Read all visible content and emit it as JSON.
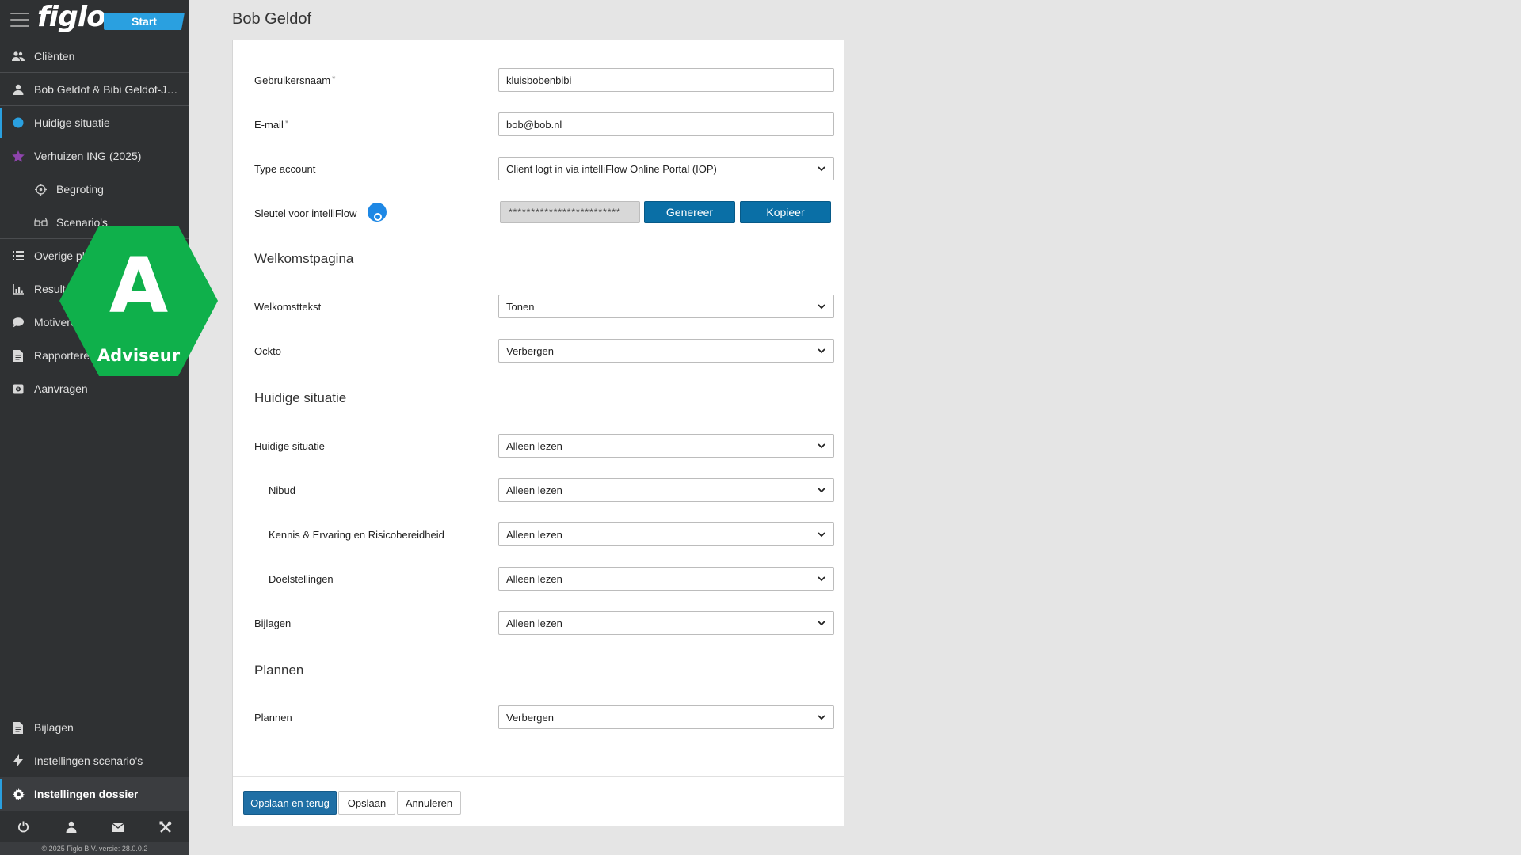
{
  "sidebar": {
    "logo": "figlo",
    "start_label": "Start",
    "items": [
      {
        "label": "Cliënten",
        "icon": "users-icon"
      },
      {
        "label": "Bob Geldof & Bibi Geldof-Jele...",
        "icon": "user-icon"
      },
      {
        "label": "Huidige situatie",
        "icon": "circle-icon"
      },
      {
        "label": "Verhuizen ING (2025)",
        "icon": "star-icon"
      },
      {
        "label": "Begroting",
        "icon": "target-icon"
      },
      {
        "label": "Scenario's",
        "icon": "glasses-icon"
      },
      {
        "label": "Overige plannen",
        "icon": "list-icon"
      },
      {
        "label": "Resultaten",
        "icon": "chart-icon"
      },
      {
        "label": "Motiveren",
        "icon": "speech-bubble-icon"
      },
      {
        "label": "Rapporteren",
        "icon": "document-icon"
      },
      {
        "label": "Aanvragen",
        "icon": "send-icon"
      }
    ],
    "bottom_items": [
      {
        "label": "Bijlagen",
        "icon": "file-icon"
      },
      {
        "label": "Instellingen scenario's",
        "icon": "bolt-icon"
      },
      {
        "label": "Instellingen dossier",
        "icon": "gear-icon"
      }
    ],
    "copyright": "© 2025 Figlo B.V. versie: 28.0.0.2"
  },
  "badge": {
    "letter": "A",
    "label": "Adviseur",
    "color": "#0fb04b"
  },
  "page": {
    "title": "Bob Geldof"
  },
  "form": {
    "username": {
      "label": "Gebruikersnaam",
      "value": "kluisbobenbibi"
    },
    "email": {
      "label": "E-mail",
      "value": "bob@bob.nl"
    },
    "account_type": {
      "label": "Type account",
      "value": "Client logt in via intelliFlow Online Portal (IOP)"
    },
    "key": {
      "label": "Sleutel voor intelliFlow",
      "value": "*************************",
      "generate": "Genereer",
      "copy": "Kopieer"
    },
    "section_welcome": "Welkomstpagina",
    "welcome_text": {
      "label": "Welkomsttekst",
      "value": "Tonen"
    },
    "ockto": {
      "label": "Ockto",
      "value": "Verbergen"
    },
    "section_current": "Huidige situatie",
    "current": {
      "label": "Huidige situatie",
      "value": "Alleen lezen"
    },
    "nibud": {
      "label": "Nibud",
      "value": "Alleen lezen"
    },
    "knowledge": {
      "label": "Kennis & Ervaring en Risicobereidheid",
      "value": "Alleen lezen"
    },
    "goals": {
      "label": "Doelstellingen",
      "value": "Alleen lezen"
    },
    "attachments": {
      "label": "Bijlagen",
      "value": "Alleen lezen"
    },
    "section_plans": "Plannen",
    "plans": {
      "label": "Plannen",
      "value": "Verbergen"
    }
  },
  "buttons": {
    "save_back": "Opslaan en terug",
    "save": "Opslaan",
    "cancel": "Annuleren"
  },
  "colors": {
    "accent": "#2aa0e0",
    "primary": "#0a6fa6",
    "sidebar": "#2f3133"
  }
}
